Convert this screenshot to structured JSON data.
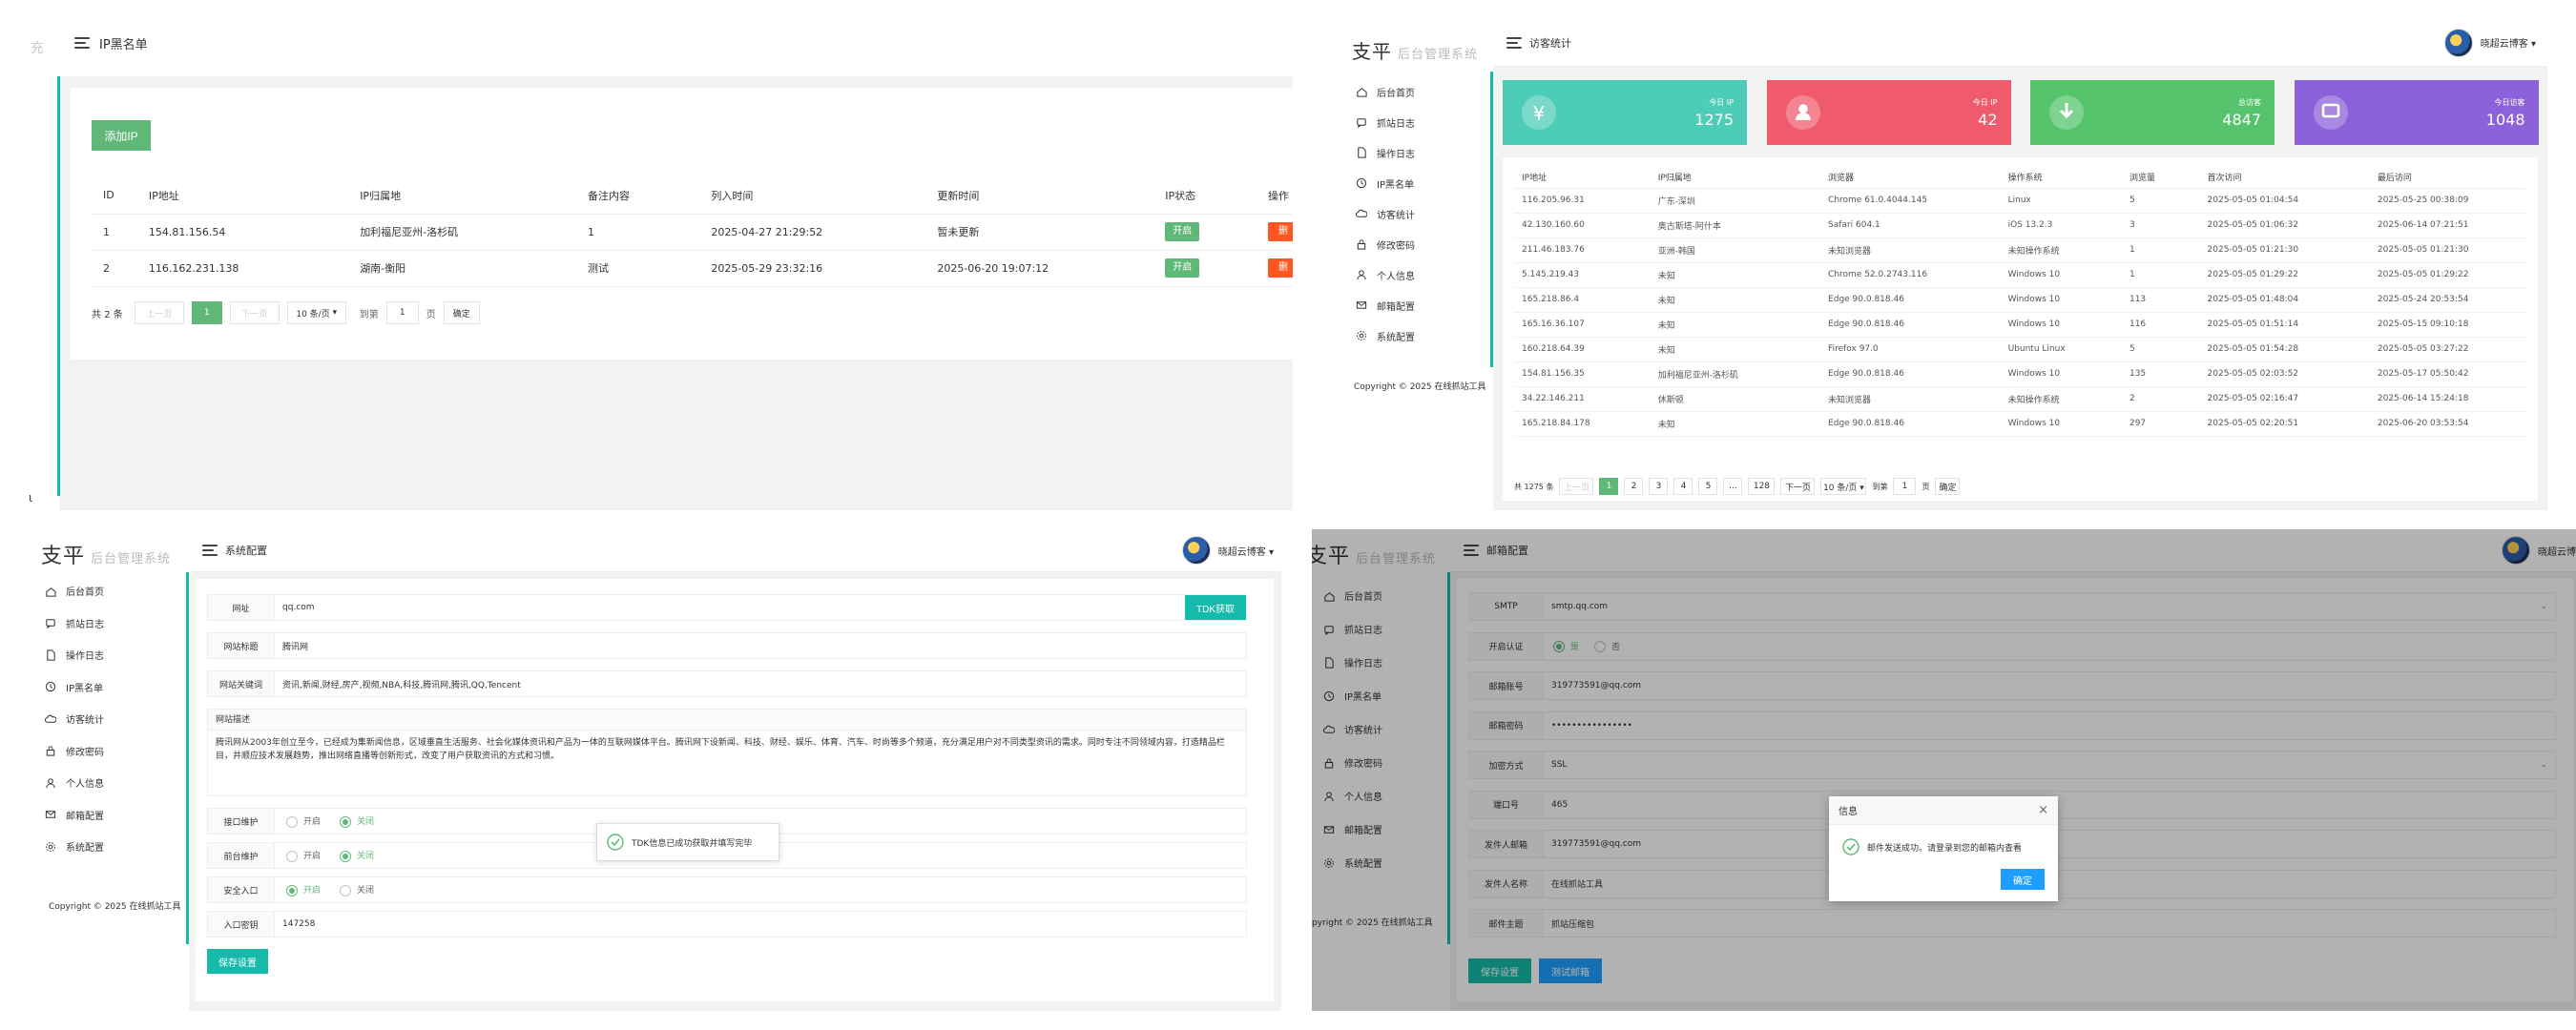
{
  "p1": {
    "sidebar_stub": "充",
    "header_title": "IP黑名单",
    "add_button": "添加IP",
    "columns": [
      "ID",
      "IP地址",
      "IP归属地",
      "备注内容",
      "列入时间",
      "更新时间",
      "IP状态",
      "操作"
    ],
    "rows": [
      {
        "id": "1",
        "ip": "154.81.156.54",
        "loc": "加利福尼亚州-洛杉矶",
        "note": "1",
        "added": "2025-04-27 21:29:52",
        "updated": "暂未更新",
        "status": "开启",
        "op": "删"
      },
      {
        "id": "2",
        "ip": "116.162.231.138",
        "loc": "湖南-衡阳",
        "note": "测试",
        "added": "2025-05-29 23:32:16",
        "updated": "2025-06-20 19:07:12",
        "status": "开启",
        "op": "删"
      }
    ],
    "pager": {
      "total": "共 2 条",
      "prev": "上一页",
      "current": "1",
      "next": "下一页",
      "size": "10 条/页",
      "goto": "到第",
      "page": "1",
      "unit": "页",
      "confirm": "确定"
    },
    "corner": "ι"
  },
  "nav": {
    "logo": "支平",
    "logo_sub": "后台管理系统",
    "items": [
      "后台首页",
      "访客统计",
      "操作日志",
      "IP黑名单",
      "访客统计",
      "修改密码",
      "个人信息",
      "邮箱配置",
      "系统配置"
    ],
    "items_p2": [
      "后台首页",
      "抓站日志",
      "操作日志",
      "IP黑名单",
      "访客统计",
      "修改密码",
      "个人信息",
      "邮箱配置",
      "系统配置"
    ],
    "copyright": "Copyright © 2025 在线抓站工具",
    "user": "晓超云博客",
    "icons": [
      "home-icon",
      "message-icon",
      "file-icon",
      "clock-icon",
      "cloud-icon",
      "lock-icon",
      "user-icon",
      "mail-icon",
      "gear-icon"
    ]
  },
  "p2": {
    "header_title": "访客统计",
    "cards": [
      {
        "label": "今日 IP",
        "value": "1275",
        "color": "#4ecdb6",
        "icon": "yen-icon"
      },
      {
        "label": "今日 IP",
        "value": "42",
        "color": "#ef5b6c",
        "icon": "user-icon"
      },
      {
        "label": "总访客",
        "value": "4847",
        "color": "#55c46d",
        "icon": "download-icon"
      },
      {
        "label": "今日访客",
        "value": "1048",
        "color": "#8b62d9",
        "icon": "chat-icon"
      }
    ],
    "columns": [
      "IP地址",
      "IP归属地",
      "浏览器",
      "操作系统",
      "浏览量",
      "首次访问",
      "最后访问"
    ],
    "rows": [
      [
        "116.205.96.31",
        "广东-深圳",
        "Chrome 61.0.4044.145",
        "Linux",
        "5",
        "2025-05-05 01:04:54",
        "2025-05-25 00:38:09"
      ],
      [
        "42.130.160.60",
        "奥古斯塔-阿什本",
        "Safari 604.1",
        "iOS 13.2.3",
        "3",
        "2025-05-05 01:06:32",
        "2025-06-14 07:21:51"
      ],
      [
        "211.46.183.76",
        "亚洲-韩国",
        "未知浏览器",
        "未知操作系统",
        "1",
        "2025-05-05 01:21:30",
        "2025-05-05 01:21:30"
      ],
      [
        "5.145.219.43",
        "未知",
        "Chrome 52.0.2743.116",
        "Windows 10",
        "1",
        "2025-05-05 01:29:22",
        "2025-05-05 01:29:22"
      ],
      [
        "165.218.86.4",
        "未知",
        "Edge 90.0.818.46",
        "Windows 10",
        "113",
        "2025-05-05 01:48:04",
        "2025-05-24 20:53:54"
      ],
      [
        "165.16.36.107",
        "未知",
        "Edge 90.0.818.46",
        "Windows 10",
        "116",
        "2025-05-05 01:51:14",
        "2025-05-15 09:10:18"
      ],
      [
        "160.218.64.39",
        "未知",
        "Firefox 97.0",
        "Ubuntu Linux",
        "5",
        "2025-05-05 01:54:28",
        "2025-05-05 03:27:22"
      ],
      [
        "154.81.156.35",
        "加利福尼亚州-洛杉矶",
        "Edge 90.0.818.46",
        "Windows 10",
        "135",
        "2025-05-05 02:03:52",
        "2025-05-17 05:50:42"
      ],
      [
        "34.22.146.211",
        "休斯顿",
        "未知浏览器",
        "未知操作系统",
        "2",
        "2025-05-05 02:16:47",
        "2025-06-14 15:24:18"
      ],
      [
        "165.218.84.178",
        "未知",
        "Edge 90.0.818.46",
        "Windows 10",
        "297",
        "2025-05-05 02:20:51",
        "2025-06-20 03:53:54"
      ]
    ],
    "pager": {
      "total": "共 1275 条",
      "prev": "上一页",
      "pages": [
        "1",
        "2",
        "3",
        "4",
        "5",
        "...",
        "128"
      ],
      "next": "下一页",
      "size": "10 条/页",
      "goto": "到第",
      "page": "1",
      "unit": "页",
      "confirm": "确定"
    }
  },
  "p3": {
    "header_title": "系统配置",
    "fields": [
      {
        "label": "网址",
        "value": "qq.com"
      },
      {
        "label": "网站标题",
        "value": "腾讯网"
      },
      {
        "label": "网站关键词",
        "value": "资讯,新闻,财经,房产,视频,NBA,科技,腾讯网,腾讯,QQ,Tencent"
      }
    ],
    "tdk_button": "TDK获取",
    "desc_label": "网站描述",
    "desc_value": "腾讯网从2003年创立至今，已经成为集新闻信息，区域垂直生活服务、社会化媒体资讯和产品为一体的互联网媒体平台。腾讯网下设新闻、科技、财经、娱乐、体育、汽车、时尚等多个频道，充分满足用户对不同类型资讯的需求。同时专注不同领域内容，打造精品栏目，并顺应技术发展趋势，推出网络直播等创新形式，改变了用户获取资讯的方式和习惯。",
    "radios": [
      {
        "label": "接口维护",
        "on": "开启",
        "off": "关闭",
        "selected": "off"
      },
      {
        "label": "前台维护",
        "on": "开启",
        "off": "关闭",
        "selected": "off"
      },
      {
        "label": "安全入口",
        "on": "开启",
        "off": "关闭",
        "selected": "on"
      }
    ],
    "entry_label": "入口密钥",
    "entry_value": "147258",
    "save_button": "保存设置",
    "toast": "TDK信息已成功获取并填写完毕"
  },
  "p4": {
    "header_title": "邮箱配置",
    "fields": [
      {
        "label": "SMTP",
        "value": "smtp.qq.com",
        "type": "select"
      },
      {
        "label": "开启认证",
        "value": "",
        "type": "radio",
        "on": "是",
        "off": "否"
      },
      {
        "label": "邮箱账号",
        "value": "319773591@qq.com",
        "type": "text"
      },
      {
        "label": "邮箱密码",
        "value": "••••••••••••••••",
        "type": "text"
      },
      {
        "label": "加密方式",
        "value": "SSL",
        "type": "select"
      },
      {
        "label": "端口号",
        "value": "465",
        "type": "text"
      },
      {
        "label": "发件人邮箱",
        "value": "319773591@qq.com",
        "type": "text"
      },
      {
        "label": "发件人名称",
        "value": "在线抓站工具",
        "type": "text"
      },
      {
        "label": "邮件主题",
        "value": "抓站压缩包",
        "type": "text"
      }
    ],
    "save_button": "保存设置",
    "test_button": "测试邮箱",
    "dialog_title": "信息",
    "dialog_msg": "邮件发送成功。请登录到您的邮箱内查看",
    "dialog_ok": "确定",
    "copyright_cut": "pyright © 2025 在线抓站工具",
    "user_cut": "晓超云博"
  },
  "colors": {
    "green": "#5fb878",
    "blue": "#1e9fff",
    "teal": "#16baaa",
    "red": "#ff5722"
  }
}
